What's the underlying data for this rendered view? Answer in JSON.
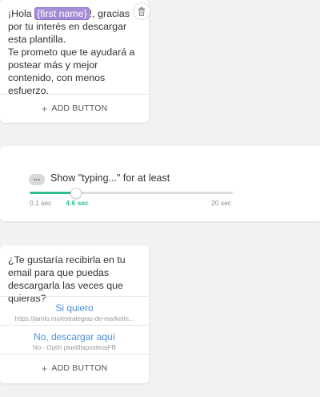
{
  "card1": {
    "text_before": "¡Hola ",
    "token": "{first name}",
    "text_after": "!, gracias por tu interés en descargar esta plantilla.",
    "line2": "Te prometo que te ayudará a postear más y mejor contenido, con menos esfuerzo.",
    "add_button": "ADD BUTTON",
    "delete_icon": "trash-icon"
  },
  "typing": {
    "label": "Show \"typing...\" for at least",
    "min_label": "0.1 sec",
    "current_label": "4.6 sec",
    "max_label": "20 sec",
    "min": 0.1,
    "max": 20,
    "value": 4.6,
    "accent": "#2fbf8f"
  },
  "card3": {
    "text": "¿Te gustaría recibirla en tu email para que puedas descargarla las veces que quieras?",
    "buttons": [
      {
        "title": "Si quiero",
        "subtitle": "https://jamlo.mx/estrategias-de-marketin..."
      },
      {
        "title": "No, descargar aquí",
        "subtitle": "No - Optin plantillaposteosFB"
      }
    ],
    "add_button": "ADD BUTTON"
  },
  "colors": {
    "token_bg": "#a58cd6",
    "link": "#4a90d9",
    "background": "#f2f2f2"
  }
}
